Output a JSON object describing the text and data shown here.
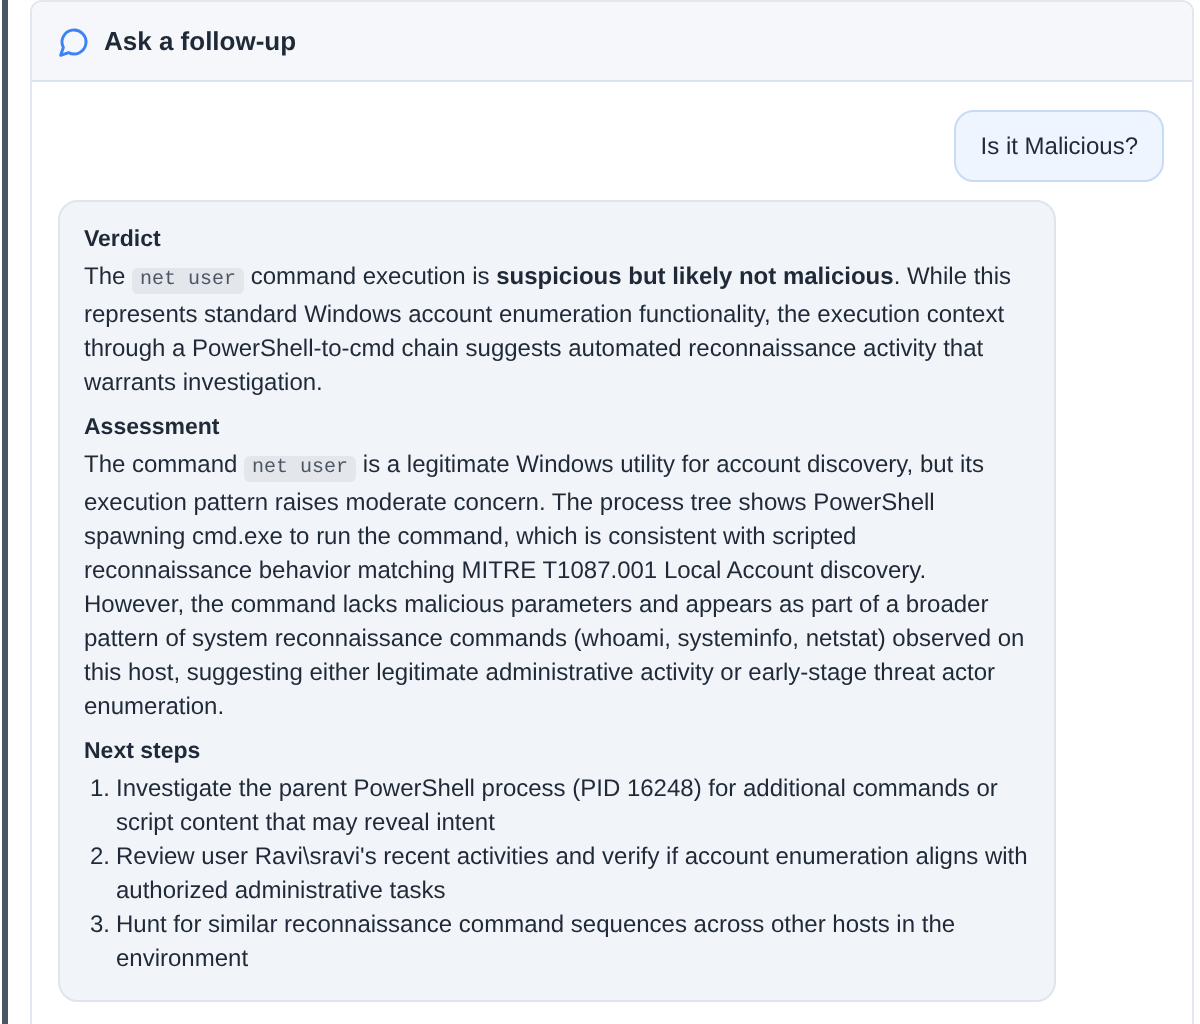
{
  "header": {
    "title": "Ask a follow-up"
  },
  "user_message": "Is it Malicious?",
  "response": {
    "sections": [
      {
        "heading": "Verdict",
        "paragraph": [
          {
            "kind": "text",
            "text": "The "
          },
          {
            "kind": "code",
            "text": "net user"
          },
          {
            "kind": "text",
            "text": " command execution is **suspicious but likely not malicious**. While this represents standard Windows account enumeration functionality, the execution context through a PowerShell-to-cmd chain suggests automated reconnaissance activity that warrants investigation."
          }
        ]
      },
      {
        "heading": "Assessment",
        "paragraph": [
          {
            "kind": "text",
            "text": "The command "
          },
          {
            "kind": "code",
            "text": "net user"
          },
          {
            "kind": "text",
            "text": " is a legitimate Windows utility for account discovery, but its execution pattern raises moderate concern. The process tree shows PowerShell spawning cmd.exe to run the command, which is consistent with scripted reconnaissance behavior matching MITRE T1087.001 Local Account discovery. However, the command lacks malicious parameters and appears as part of a broader pattern of system reconnaissance commands (whoami, systeminfo, netstat) observed on this host, suggesting either legitimate administrative activity or early-stage threat actor enumeration."
          }
        ]
      },
      {
        "heading": "Next steps",
        "steps": [
          {
            "number": "1.",
            "text": "Investigate the parent PowerShell process (PID 16248) for additional commands or script content that may reveal intent"
          },
          {
            "number": "2.",
            "text": "Review user Ravi\\sravi's recent activities and verify if account enumeration aligns with authorized administrative tasks"
          },
          {
            "number": "3.",
            "text": "Hunt for similar reconnaissance command sequences across other hosts in the environment"
          }
        ]
      }
    ]
  }
}
